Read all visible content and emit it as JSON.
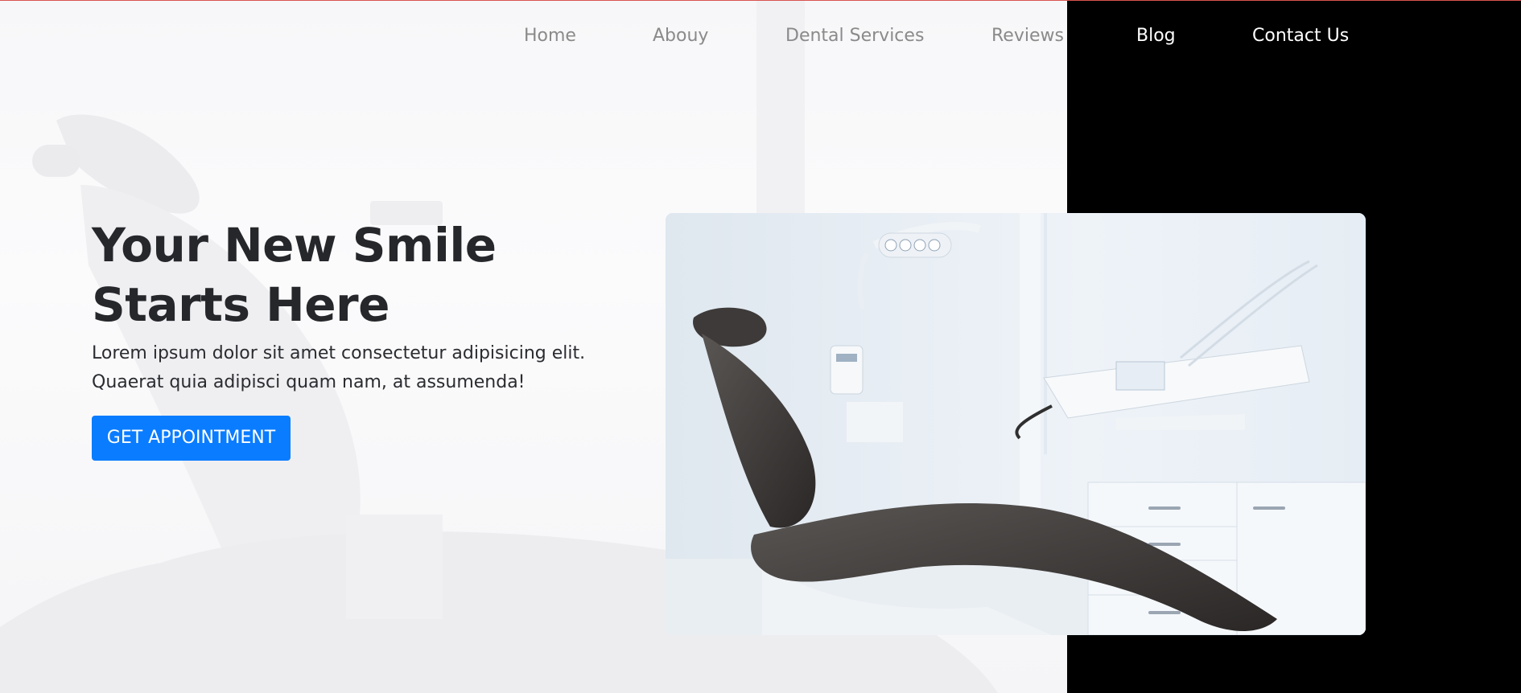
{
  "nav": {
    "items": [
      {
        "label": "Home"
      },
      {
        "label": "Abouy"
      },
      {
        "label": "Dental Services"
      },
      {
        "label": "Reviews"
      },
      {
        "label": "Blog"
      },
      {
        "label": "Contact Us"
      }
    ]
  },
  "hero": {
    "title": "Your New Smile Starts Here",
    "description": "Lorem ipsum dolor sit amet consectetur adipisicing elit. Quaerat quia adipisci quam nam, at assumenda!",
    "cta_label": "GET APPOINTMENT"
  },
  "colors": {
    "accent": "#0a7cff",
    "panel": "#000000",
    "nav_text": "#8a8a8a",
    "nav_text_on_dark": "#ffffff",
    "top_border": "#d9534f"
  }
}
